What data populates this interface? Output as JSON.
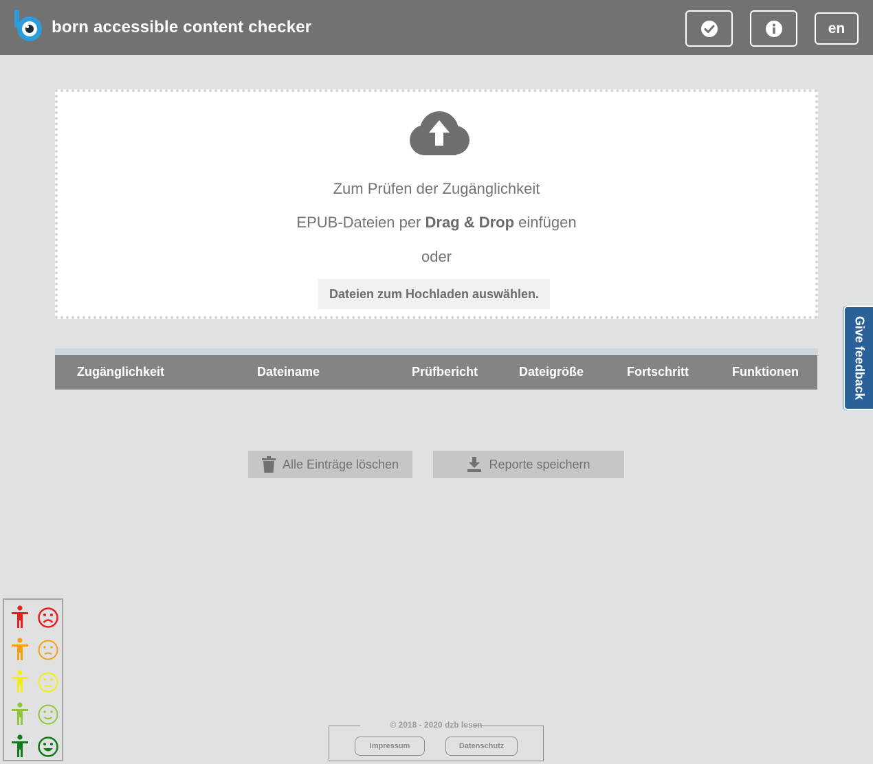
{
  "header": {
    "title": "born accessible content checker",
    "check_icon": "check-circle-icon",
    "info_icon": "info-circle-icon",
    "language": "en"
  },
  "dropzone": {
    "icon": "cloud-upload-icon",
    "line1": "Zum Prüfen der Zugänglichkeit",
    "line2_prefix": "EPUB-Dateien per ",
    "line2_bold": "Drag & Drop",
    "line2_suffix": " einfügen",
    "line3": "oder",
    "select_button": "Dateien zum Hochladen auswählen."
  },
  "table": {
    "columns": [
      "Zugänglichkeit",
      "Dateiname",
      "Prüfbericht",
      "Dateigröße",
      "Fortschritt",
      "Funktionen"
    ],
    "rows": []
  },
  "actions": {
    "delete_all": "Alle Einträge löschen",
    "delete_icon": "trash-icon",
    "save_reports": "Reporte speichern",
    "save_icon": "download-icon"
  },
  "feedback": {
    "label": "Give feedback"
  },
  "rating_legend": {
    "levels": [
      {
        "color": "#e81d1d",
        "face": "sad"
      },
      {
        "color": "#f5a10f",
        "face": "slightly-sad"
      },
      {
        "color": "#f3ef12",
        "face": "neutral"
      },
      {
        "color": "#8fc738",
        "face": "slightly-happy"
      },
      {
        "color": "#0b7a17",
        "face": "happy"
      }
    ]
  },
  "footer": {
    "copyright": "© 2018 - 2020 dzb lesen",
    "impressum": "Impressum",
    "datenschutz": "Datenschutz"
  }
}
